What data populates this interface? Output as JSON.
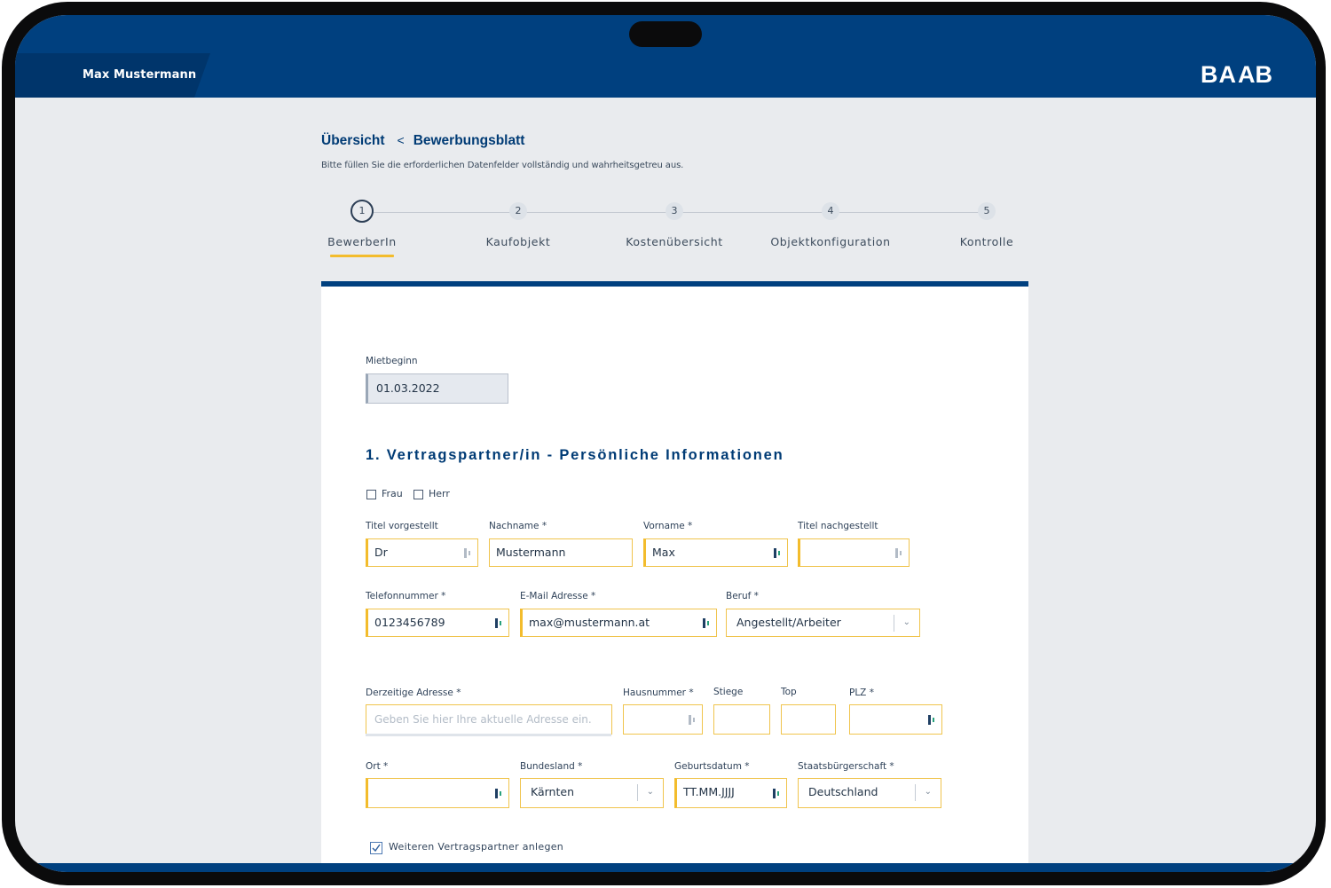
{
  "header": {
    "user_name": "Max Mustermann",
    "logo_text": "BAAB"
  },
  "breadcrumb": {
    "parent": "Übersicht",
    "separator": "<",
    "current": "Bewerbungsblatt"
  },
  "subtitle": "Bitte füllen Sie die erforderlichen Datenfelder vollständig und wahrheitsgetreu aus.",
  "steps": [
    {
      "number": "1",
      "label": "BewerberIn",
      "active": true
    },
    {
      "number": "2",
      "label": "Kaufobjekt"
    },
    {
      "number": "3",
      "label": "Kostenübersicht"
    },
    {
      "number": "4",
      "label": "Objektkonfiguration"
    },
    {
      "number": "5",
      "label": "Kontrolle"
    }
  ],
  "form": {
    "mietbeginn": {
      "label": "Mietbeginn",
      "value": "01.03.2022"
    },
    "section_title": "1. Vertragspartner/in - Persönliche Informationen",
    "salutation": {
      "frau": "Frau",
      "herr": "Herr"
    },
    "titel_vor": {
      "label": "Titel vorgestellt",
      "value": "Dr"
    },
    "nachname": {
      "label": "Nachname *",
      "value": "Mustermann"
    },
    "vorname": {
      "label": "Vorname *",
      "value": "Max"
    },
    "titel_nach": {
      "label": "Titel nachgestellt",
      "value": ""
    },
    "telefon": {
      "label": "Telefonnummer  *",
      "value": "0123456789"
    },
    "email": {
      "label": "E-Mail Adresse  *",
      "value": "max@mustermann.at"
    },
    "beruf": {
      "label": "Beruf  *",
      "value": "Angestellt/Arbeiter"
    },
    "adresse": {
      "label": "Derzeitige Adresse *",
      "placeholder": "Geben Sie hier Ihre aktuelle Adresse ein."
    },
    "hausnummer": {
      "label": "Hausnummer  *",
      "value": ""
    },
    "stiege": {
      "label": "Stiege",
      "value": ""
    },
    "top": {
      "label": "Top",
      "value": ""
    },
    "plz": {
      "label": "PLZ  *",
      "value": ""
    },
    "ort": {
      "label": "Ort  *",
      "value": ""
    },
    "bundesland": {
      "label": "Bundesland  *",
      "value": "Kärnten"
    },
    "geburtsdatum": {
      "label": "Geburtsdatum  *",
      "value": "TT.MM.JJJJ"
    },
    "staatsbuergerschaft": {
      "label": "Staatsbürgerschaft  *",
      "value": "Deutschland"
    },
    "weiterer_partner": {
      "label": "Weiteren Vertragspartner anlegen",
      "checked": true
    }
  },
  "colors": {
    "primary": "#00407f",
    "accent": "#f3bc2c",
    "background": "#e9ebee"
  }
}
